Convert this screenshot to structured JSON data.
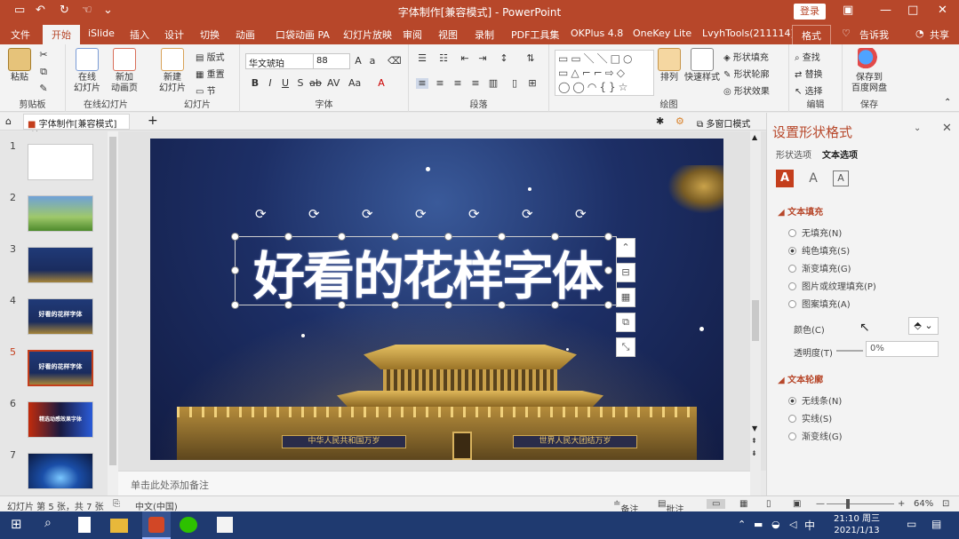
{
  "window": {
    "title": "字体制作[兼容模式] - PowerPoint",
    "login_label": "登录"
  },
  "menu": {
    "tabs": [
      "文件",
      "开始",
      "iSlide",
      "插入",
      "设计",
      "切换",
      "动画",
      "口袋动画 PA",
      "幻灯片放映",
      "审阅",
      "视图",
      "录制",
      "PDF工具集",
      "OKPlus 4.8",
      "OneKey Lite",
      "LvyhTools(211114)",
      "格式"
    ],
    "active_tab": "开始",
    "tell_me": "告诉我",
    "share": "共享"
  },
  "ribbon": {
    "clipboard": {
      "label": "剪贴板",
      "paste": "粘贴"
    },
    "slides": {
      "label": "幻灯片",
      "online": "在线\n幻灯片",
      "new_anim": "新加\n动画页",
      "new_slide": "新建\n幻灯片",
      "layout": "版式",
      "reset": "重置",
      "section": "节",
      "online_group": "在线幻灯片"
    },
    "font": {
      "label": "字体",
      "font_name": "华文琥珀",
      "font_size": "88"
    },
    "paragraph": {
      "label": "段落"
    },
    "drawing": {
      "label": "绘图",
      "arrange": "排列",
      "quick_styles": "快速样式",
      "shape_fill": "形状填充",
      "shape_outline": "形状轮廓",
      "shape_effects": "形状效果"
    },
    "editing": {
      "label": "编辑",
      "find": "查找",
      "replace": "替换",
      "select": "选择"
    },
    "save": {
      "label": "保存",
      "save_baidu": "保存到\n百度网盘"
    }
  },
  "doc_tabs": {
    "active": "字体制作[兼容模式]",
    "multi_window": "多窗口模式"
  },
  "thumbnails": {
    "numbers": [
      "1",
      "2",
      "3",
      "4",
      "5",
      "6",
      "7"
    ],
    "selected": 5,
    "slide4_text": "好看的花样字体",
    "slide5_text": "好看的花样字体",
    "slide6_text": "精选动感效果字体"
  },
  "slide": {
    "headline": "好看的花样字体",
    "left_banner": "中华人民共和国万岁",
    "right_banner": "世界人民大团结万岁"
  },
  "notes_placeholder": "单击此处添加备注",
  "format_pane": {
    "title": "设置形状格式",
    "tab_shape": "形状选项",
    "tab_text": "文本选项",
    "text_fill": {
      "header": "文本填充",
      "options": [
        "无填充(N)",
        "纯色填充(S)",
        "渐变填充(G)",
        "图片或纹理填充(P)",
        "图案填充(A)"
      ],
      "selected": "纯色填充(S)",
      "color_label": "颜色(C)",
      "transparency_label": "透明度(T)",
      "transparency_value": "0%"
    },
    "text_outline": {
      "header": "文本轮廓",
      "options": [
        "无线条(N)",
        "实线(S)",
        "渐变线(G)"
      ],
      "selected": "无线条(N)"
    }
  },
  "status": {
    "slide_info": "幻灯片 第 5 张，共 7 张",
    "language": "中文(中国)",
    "notes": "备注",
    "comments": "批注",
    "zoom": "64%"
  },
  "taskbar": {
    "time": "21:10 周三",
    "date": "2021/1/13",
    "ime": "中"
  },
  "colors": {
    "accent": "#b7472a",
    "title_fill": "#ffffff",
    "selected_thumb_border": "#c43e1c"
  }
}
